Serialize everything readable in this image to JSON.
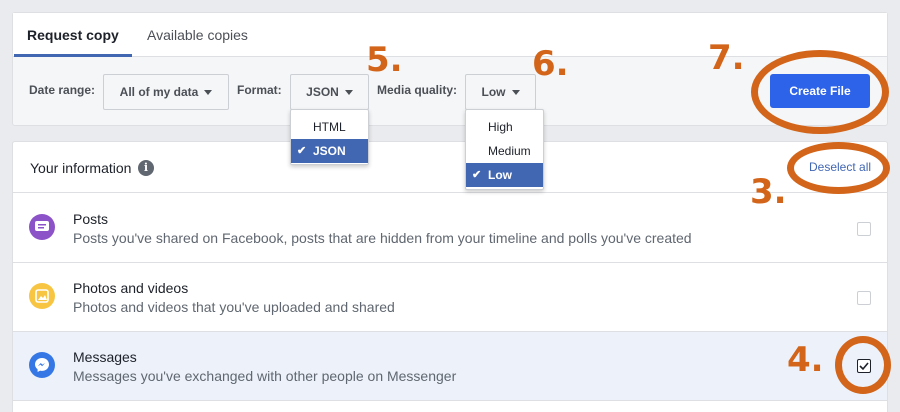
{
  "tabs": [
    {
      "label": "Request copy",
      "active": true
    },
    {
      "label": "Available copies",
      "active": false
    }
  ],
  "filters": {
    "date_range_label": "Date range:",
    "date_range_value": "All of my data",
    "format_label": "Format:",
    "format_value": "JSON",
    "media_quality_label": "Media quality:",
    "media_quality_value": "Low",
    "create_button": "Create File"
  },
  "format_menu": {
    "options": [
      "HTML",
      "JSON"
    ],
    "selected": "JSON"
  },
  "quality_menu": {
    "options": [
      "High",
      "Medium",
      "Low"
    ],
    "selected": "Low"
  },
  "info": {
    "title": "Your information",
    "info_icon": "i",
    "deselect_label": "Deselect all",
    "rows": [
      {
        "title": "Posts",
        "description": "Posts you've shared on Facebook, posts that are hidden from your timeline and polls you've created",
        "icon": "posts-icon",
        "color": "#8c52c8",
        "checked": false
      },
      {
        "title": "Photos and videos",
        "description": "Photos and videos that you've uploaded and shared",
        "icon": "photos-icon",
        "color": "#f7c542",
        "checked": false
      },
      {
        "title": "Messages",
        "description": "Messages you've exchanged with other people on Messenger",
        "icon": "messenger-icon",
        "color": "#3578e5",
        "checked": true
      }
    ]
  },
  "annotations": {
    "step3": "3.",
    "step4": "4.",
    "step5": "5.",
    "step6": "6.",
    "step7": "7."
  },
  "colors": {
    "accent": "#4267b2",
    "button": "#2d63e8",
    "annotation": "#d2651a"
  }
}
